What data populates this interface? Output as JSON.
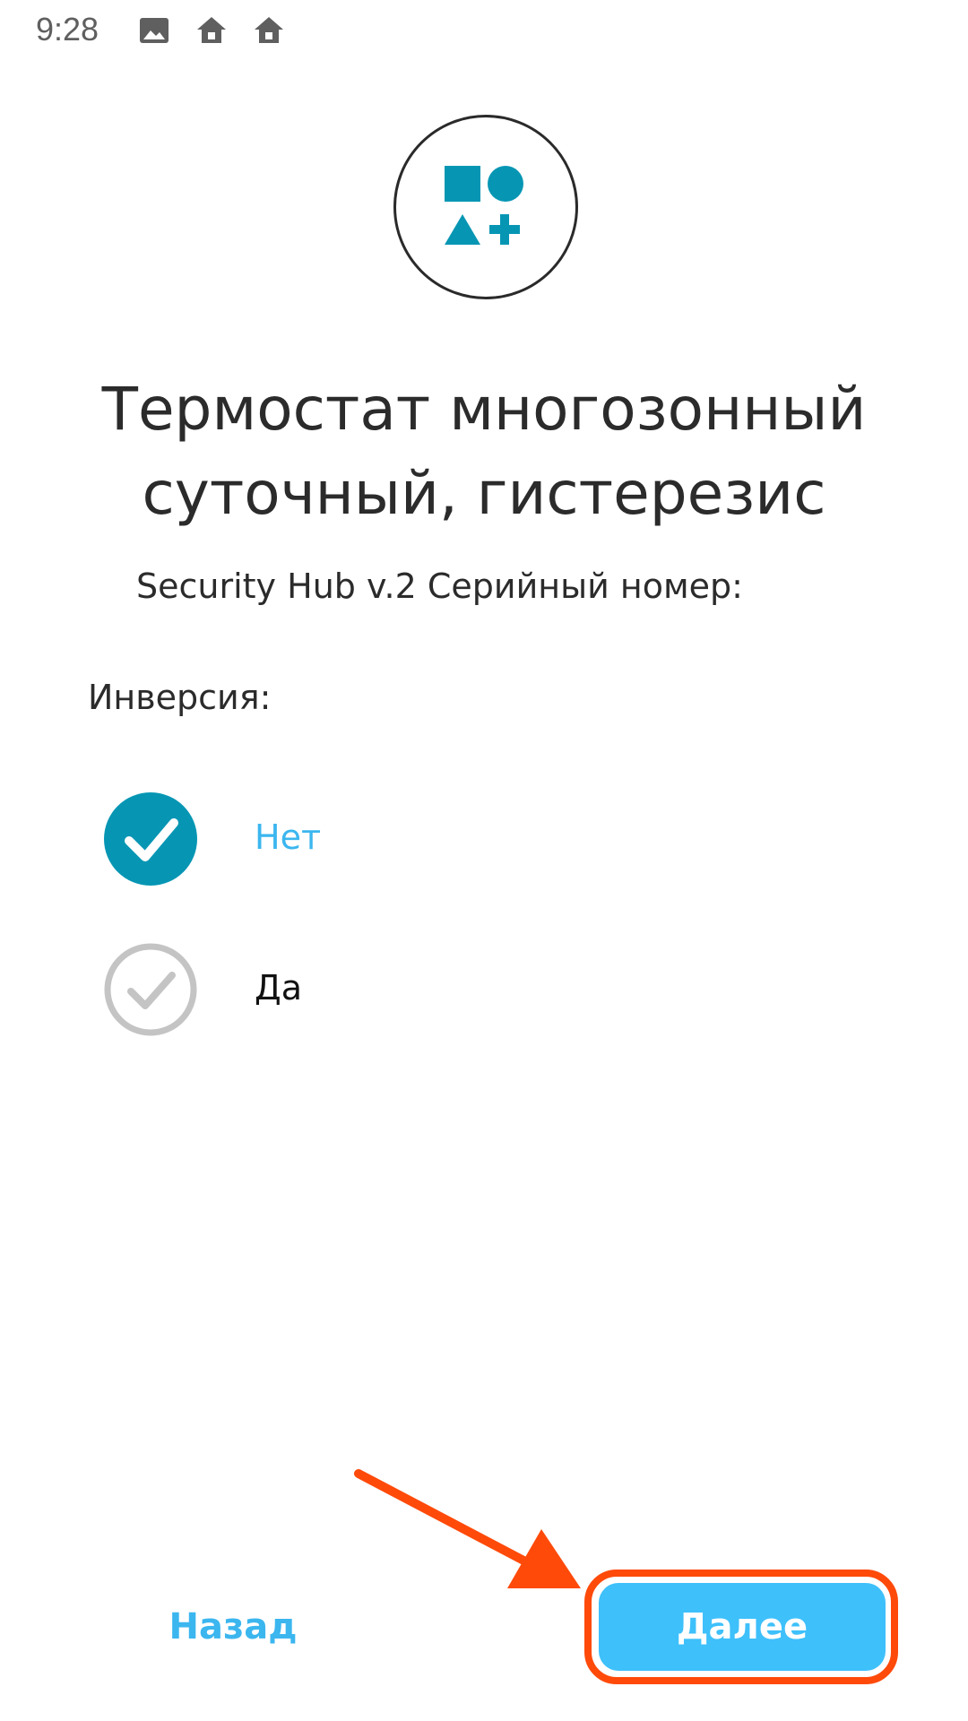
{
  "status_bar": {
    "time": "9:28",
    "icons": [
      "image-icon",
      "home-icon",
      "home-icon"
    ]
  },
  "header": {
    "logo_icon": "shapes-icon",
    "accent_color": "#0696b4",
    "title": "Термостат многозонный суточный, гистерезис",
    "serial_label": "Security Hub v.2 Серийный номер:"
  },
  "settings": {
    "section_label": "Инверсия:",
    "options": [
      {
        "label": "Нет",
        "selected": true,
        "color": "#3bb6ef"
      },
      {
        "label": "Да",
        "selected": false,
        "color": "#111111"
      }
    ]
  },
  "footer": {
    "back_label": "Назад",
    "next_label": "Далее",
    "next_color": "#3ec0fb",
    "highlight_color": "#ff4a0a"
  }
}
